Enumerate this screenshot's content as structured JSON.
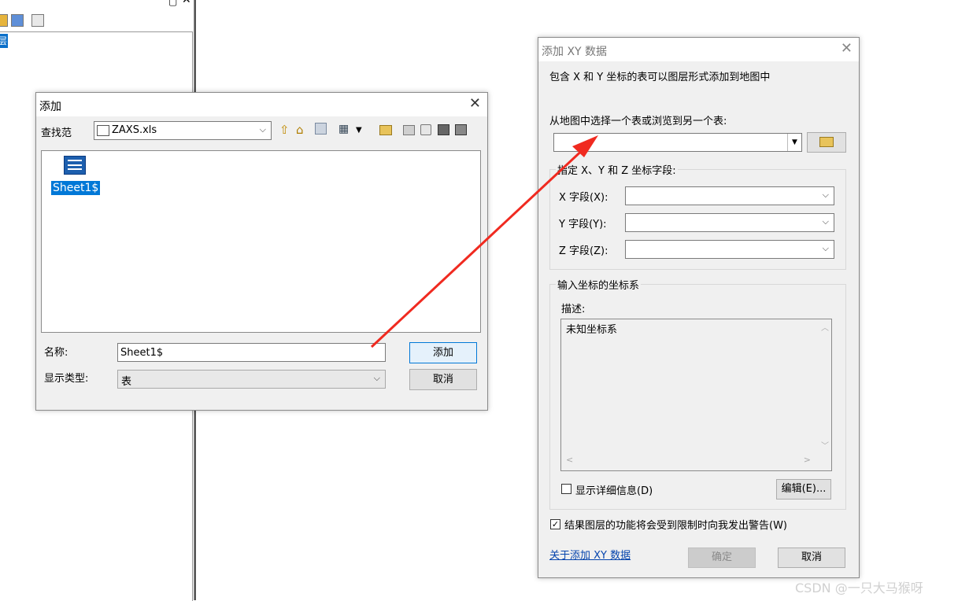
{
  "background": {
    "layer_tag": "层"
  },
  "add_dialog": {
    "title": "添加",
    "lookin_label": "查找范",
    "lookin_value": "ZAXS.xls",
    "items": [
      {
        "label": "Sheet1$"
      }
    ],
    "name_label": "名称:",
    "name_value": "Sheet1$",
    "type_label": "显示类型:",
    "type_value": "表",
    "add_button": "添加",
    "cancel_button": "取消"
  },
  "xy_dialog": {
    "title": "添加 XY 数据",
    "description": "包含 X 和 Y 坐标的表可以图层形式添加到地图中",
    "choose_label": "从地图中选择一个表或浏览到另一个表:",
    "table_value": "",
    "fields_group": "指定 X、Y 和 Z 坐标字段:",
    "x_label": "X 字段(X):",
    "y_label": "Y 字段(Y):",
    "z_label": "Z 字段(Z):",
    "x_value": "",
    "y_value": "",
    "z_value": "",
    "coord_group": "输入坐标的坐标系",
    "desc_label": "描述:",
    "coord_text": "未知坐标系",
    "details_label": "显示详细信息(D)",
    "details_checked": false,
    "edit_button": "编辑(E)...",
    "warn_label": "结果图层的功能将会受到限制时向我发出警告(W)",
    "warn_checked": true,
    "help_link": "关于添加 XY 数据",
    "ok_button": "确定",
    "cancel_button": "取消"
  },
  "watermark": "CSDN @一只大马猴呀",
  "colors": {
    "arrow": "#f02a20",
    "selection": "#0078d7",
    "link": "#0645ad"
  }
}
